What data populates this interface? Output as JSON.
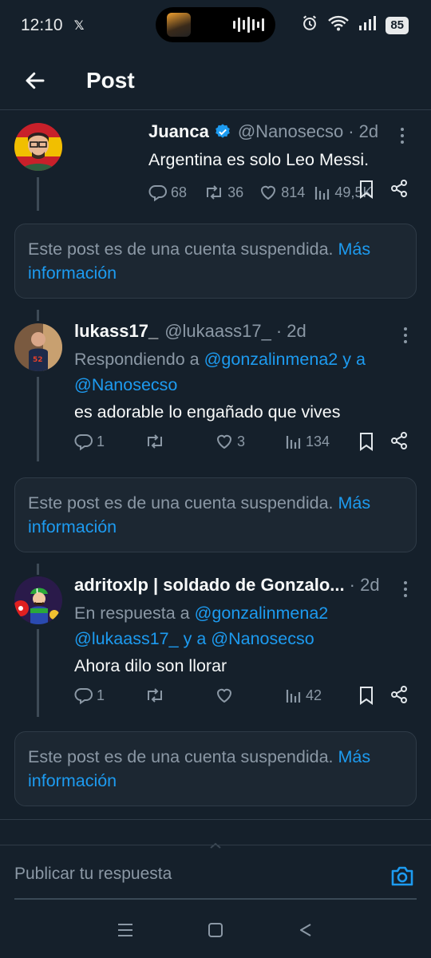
{
  "status_bar": {
    "time": "12:10",
    "x_badge": "𝕏",
    "battery": "85"
  },
  "header": {
    "title": "Post"
  },
  "posts": [
    {
      "author": "Juanca",
      "verified": true,
      "handle": "@Nanosecso",
      "time": "· 2d",
      "text": "Argentina es solo Leo Messi.",
      "replies": "68",
      "reposts": "36",
      "likes": "814",
      "views": "49,5K"
    },
    {
      "author": "lukass17_",
      "verified": false,
      "handle": "@lukaass17_",
      "time": "· 2d",
      "reply_prefix": "Respondiendo a",
      "reply_mention_1": "@gonzalinmena2",
      "reply_joiner": "y a",
      "reply_mention_2": "@Nanosecso",
      "text": "es adorable lo engañado que vives",
      "replies": "1",
      "reposts": "",
      "likes": "3",
      "views": "134"
    },
    {
      "author": "adritoxlp | soldado de Gonzalo...",
      "verified": false,
      "handle": "",
      "time": "· 2d",
      "reply_prefix": "En respuesta a",
      "reply_mention_1": "@gonzalinmena2",
      "reply_mention_2": "@lukaass17_",
      "reply_joiner": "y a",
      "reply_mention_3": "@Nanosecso",
      "text": "Ahora dilo son llorar",
      "replies": "1",
      "reposts": "",
      "likes": "",
      "views": "42"
    }
  ],
  "suspended_notice": {
    "text": "Este post es de una cuenta suspendida.",
    "link_1": "Más",
    "link_2": "información"
  },
  "reply_bar": {
    "placeholder": "Publicar tu respuesta"
  },
  "colors": {
    "background": "#15202b",
    "accent": "#1d9bf0",
    "muted": "#8b98a5",
    "card": "#1c2732"
  }
}
